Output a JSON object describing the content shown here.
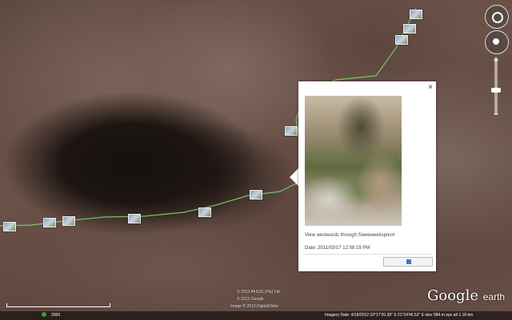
{
  "map": {
    "type": "satellite",
    "app": "Google earth"
  },
  "balloon": {
    "close_label": "×",
    "caption": "View westwards through Seweweekspoort",
    "date": "Date: 2011/03/17 12:58:19 PM"
  },
  "nav": {
    "zoom_plus": "+",
    "zoom_minus": "−"
  },
  "logo": {
    "main": "Google",
    "sub": "earth"
  },
  "credits": {
    "line1": "© 2013 AfriGIS (Pty) Ltd.",
    "line2": "© 2013 Google",
    "line3": "Image © 2013 DigitalGlobe"
  },
  "status": {
    "text": "Imagery Date: 4/18/2012   33°17'20.28\" S   21°24'46.52\" E   elev  584 m    eye alt  1.18 km",
    "scale_label": "2000"
  }
}
